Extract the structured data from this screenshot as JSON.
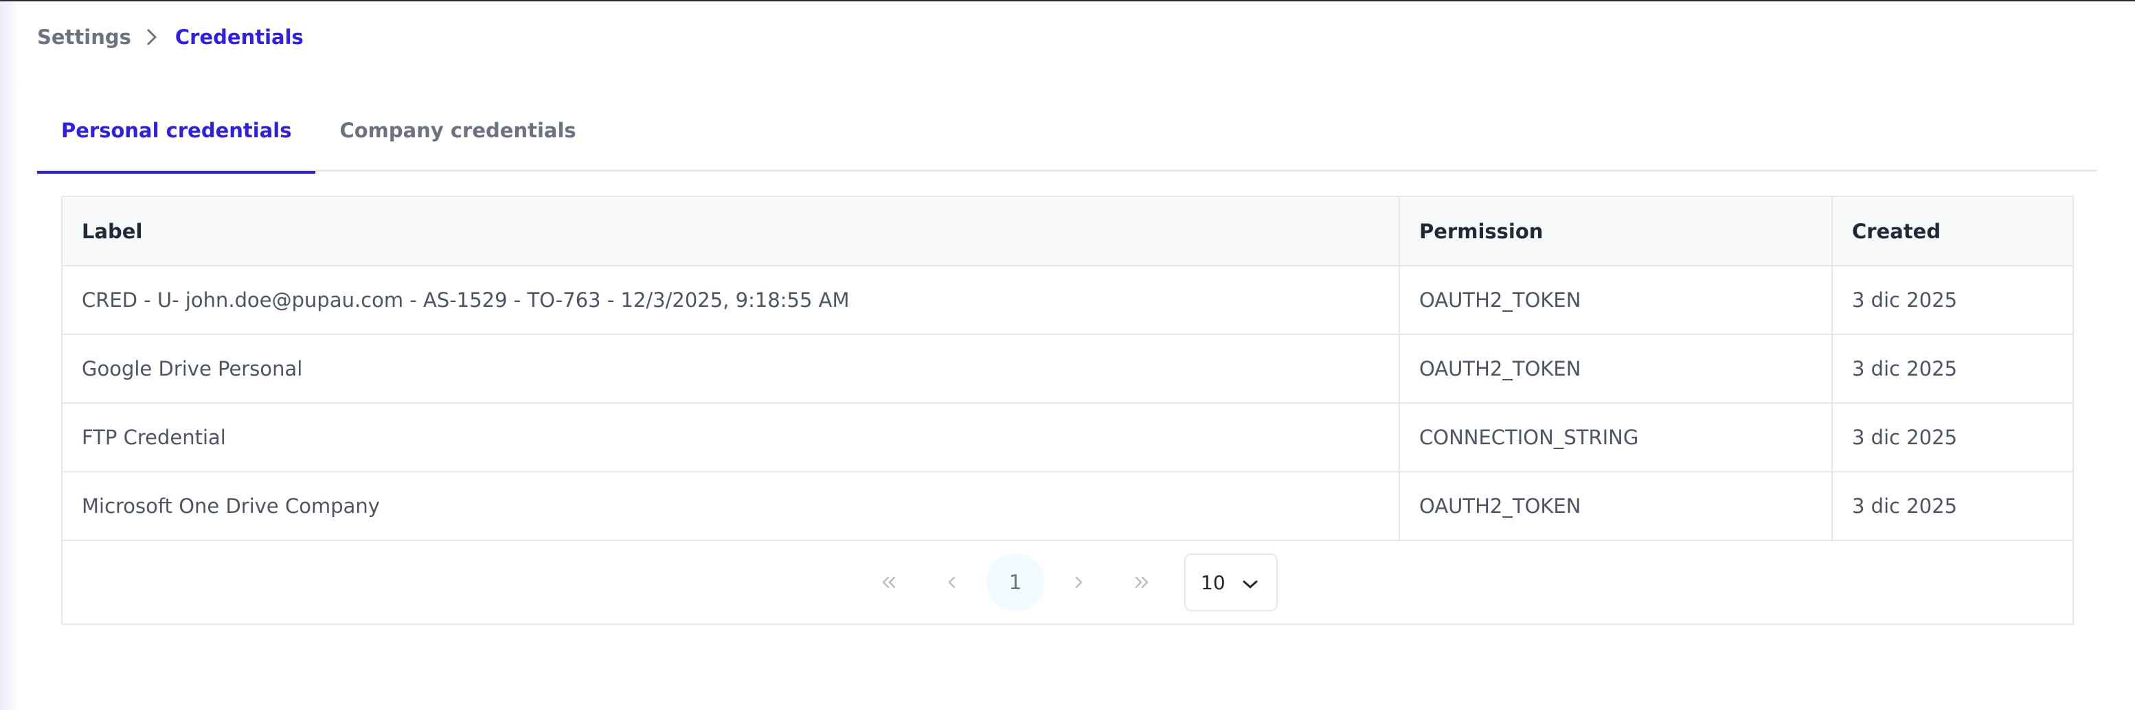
{
  "breadcrumb": {
    "parent": "Settings",
    "current": "Credentials"
  },
  "tabs": [
    {
      "label": "Personal credentials",
      "active": true
    },
    {
      "label": "Company credentials",
      "active": false
    }
  ],
  "table": {
    "headers": {
      "label": "Label",
      "permission": "Permission",
      "created": "Created"
    },
    "rows": [
      {
        "label": "CRED - U- john.doe@pupau.com - AS-1529 - TO-763 - 12/3/2025, 9:18:55 AM",
        "permission": "OAUTH2_TOKEN",
        "created": "3 dic 2025"
      },
      {
        "label": "Google Drive Personal",
        "permission": "OAUTH2_TOKEN",
        "created": "3 dic 2025"
      },
      {
        "label": "FTP Credential",
        "permission": "CONNECTION_STRING",
        "created": "3 dic 2025"
      },
      {
        "label": "Microsoft One Drive Company",
        "permission": "OAUTH2_TOKEN",
        "created": "3 dic 2025"
      }
    ]
  },
  "pagination": {
    "first_icon": "first-page-icon",
    "prev_icon": "prev-page-icon",
    "current_page": "1",
    "next_icon": "next-page-icon",
    "last_icon": "last-page-icon",
    "page_size": "10"
  },
  "colors": {
    "accent": "#2f1ee6",
    "current_page_bg": "#effbfe"
  }
}
